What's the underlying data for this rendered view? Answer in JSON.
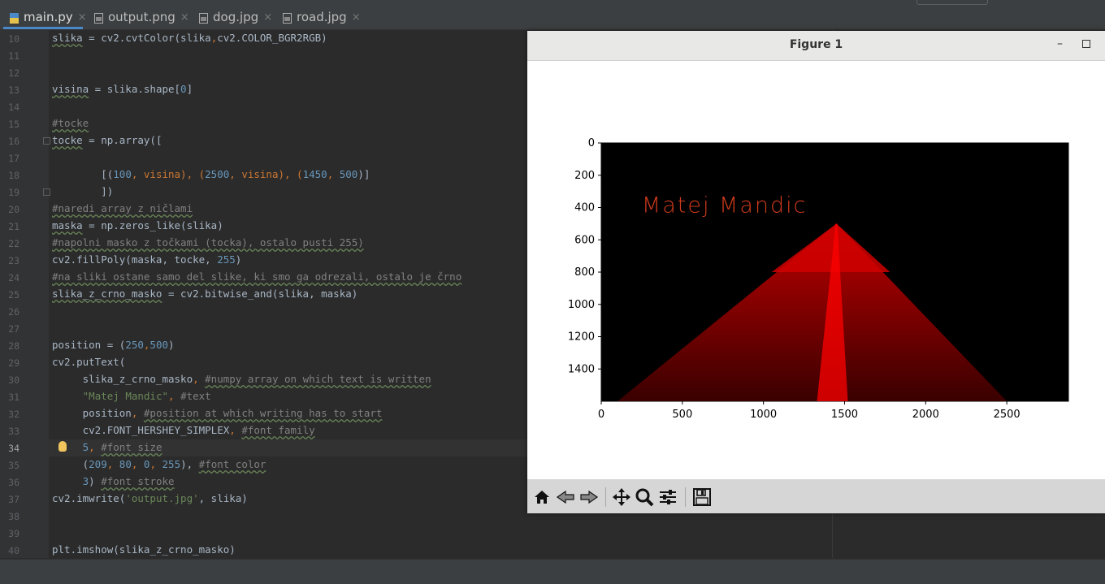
{
  "tabs": [
    {
      "label": "main.py",
      "active": true,
      "icon": "python-file-icon"
    },
    {
      "label": "output.png",
      "active": false,
      "icon": "image-file-icon"
    },
    {
      "label": "dog.jpg",
      "active": false,
      "icon": "image-file-icon"
    },
    {
      "label": "road.jpg",
      "active": false,
      "icon": "image-file-icon"
    }
  ],
  "tab_close": "×",
  "line_numbers": [
    "10",
    "11",
    "12",
    "13",
    "14",
    "15",
    "16",
    "17",
    "18",
    "19",
    "20",
    "21",
    "22",
    "23",
    "24",
    "25",
    "26",
    "27",
    "28",
    "29",
    "30",
    "31",
    "32",
    "33",
    "34",
    "35",
    "36",
    "37",
    "38",
    "39",
    "40"
  ],
  "current_line": "34",
  "code": {
    "l10": {
      "a": "slika",
      "b": " = cv2.cvtColor(slika",
      "c": ",",
      "d": "cv2.COLOR_BGR2RGB)"
    },
    "l13": {
      "a": "visina",
      "b": " = slika.shape[",
      "c": "0",
      "d": "]"
    },
    "l15": "#tocke",
    "l16": {
      "a": "tocke",
      "b": " = np.array(["
    },
    "l18": {
      "a": "        [(",
      "b": "100",
      "c": ", visina), (",
      "d": "2500",
      "e": ", visina), (",
      "f": "1450",
      "g": ", ",
      "h": "500",
      "i": ")]"
    },
    "l19": "        ])",
    "l20": "#naredi array z ničlami",
    "l21": {
      "a": "maska",
      "b": " = np.zeros_like(slika)"
    },
    "l22": "#napolni masko z točkami (tocka), ostalo pusti 255)",
    "l23": {
      "a": "cv2.fillPoly(maska, tocke, ",
      "b": "255",
      "c": ")"
    },
    "l24": "#na sliki ostane samo del slike, ki smo ga odrezali, ostalo je črno",
    "l25": {
      "a": "slika_z_crno_masko",
      "b": " = cv2.bitwise_and(slika, maska)"
    },
    "l28": {
      "a": "position = (",
      "b": "250",
      "c": ",",
      "d": "500",
      "e": ")"
    },
    "l29": "cv2.putText(",
    "l30": {
      "a": "     slika_z_crno_masko",
      "b": ", ",
      "c": "#numpy array on which text is written"
    },
    "l31": {
      "a": "     ",
      "b": "\"Matej Mandic\"",
      "c": ", ",
      "d": "#text"
    },
    "l32": {
      "a": "     position",
      "b": ", ",
      "c": "#position at which writing has to start"
    },
    "l33": {
      "a": "     cv2.FONT_HERSHEY_SIMPLEX",
      "b": ", ",
      "c": "#font family"
    },
    "l34": {
      "a": "     ",
      "b": "5",
      "c": ", ",
      "d": "#font size"
    },
    "l35": {
      "a": "     (",
      "b": "209",
      "c": ", ",
      "d": "80",
      "e": ", ",
      "f": "0",
      "g": ", ",
      "h": "255",
      "i": "), ",
      "j": "#font color"
    },
    "l36": {
      "a": "     ",
      "b": "3",
      "c": ") ",
      "d": "#font stroke"
    },
    "l37": {
      "a": "cv2.imwrite(",
      "b": "'output.jpg'",
      "c": ", slika)"
    },
    "l40": "plt.imshow(slika_z_crno_masko)"
  },
  "figure": {
    "title": "Figure 1",
    "minimize": "–",
    "image_text": "Matej Mandic",
    "text_color": "#d13a1b",
    "road_color": "#e00000",
    "toolbar": [
      "home-icon",
      "back-icon",
      "forward-icon",
      "pan-icon",
      "zoom-icon",
      "configure-subplots-icon",
      "save-icon"
    ]
  },
  "chart_data": {
    "type": "image",
    "xlim": [
      0,
      2880
    ],
    "ylim": [
      1600,
      0
    ],
    "xticks": [
      0,
      500,
      1000,
      1500,
      2000,
      2500
    ],
    "yticks": [
      0,
      200,
      400,
      600,
      800,
      1000,
      1200,
      1400
    ],
    "polygon": [
      [
        100,
        1600
      ],
      [
        2500,
        1600
      ],
      [
        1450,
        500
      ]
    ],
    "text": {
      "value": "Matej Mandic",
      "x": 250,
      "y": 500
    }
  }
}
